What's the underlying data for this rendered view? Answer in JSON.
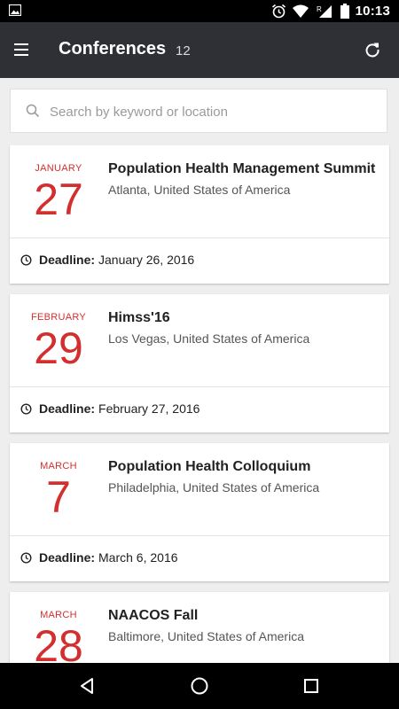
{
  "status_bar": {
    "time": "10:13",
    "icons": [
      "image-icon",
      "alarm-icon",
      "wifi-icon",
      "signal-icon",
      "battery-icon"
    ]
  },
  "app_bar": {
    "title": "Conferences",
    "count": "12",
    "icons": [
      "menu-icon",
      "refresh-icon"
    ],
    "background_color": "#2e3035"
  },
  "search": {
    "placeholder": "Search by keyword or location",
    "value": ""
  },
  "accent_color": "#d32f2f",
  "deadline_label": "Deadline:",
  "conferences": [
    {
      "month": "JANUARY",
      "day": "27",
      "name": "Population Health Management Summit",
      "location": "Atlanta, United States of America",
      "deadline": "January 26, 2016"
    },
    {
      "month": "FEBRUARY",
      "day": "29",
      "name": "Himss'16",
      "location": "Los Vegas, United States of America",
      "deadline": "February 27, 2016"
    },
    {
      "month": "MARCH",
      "day": "7",
      "name": "Population Health Colloquium",
      "location": "Philadelphia, United States of America",
      "deadline": "March 6, 2016"
    },
    {
      "month": "MARCH",
      "day": "28",
      "name": "NAACOS Fall",
      "location": "Baltimore, United States of America",
      "deadline": ""
    }
  ],
  "nav_bar": {
    "icons": [
      "back-icon",
      "home-icon",
      "recents-icon"
    ]
  }
}
